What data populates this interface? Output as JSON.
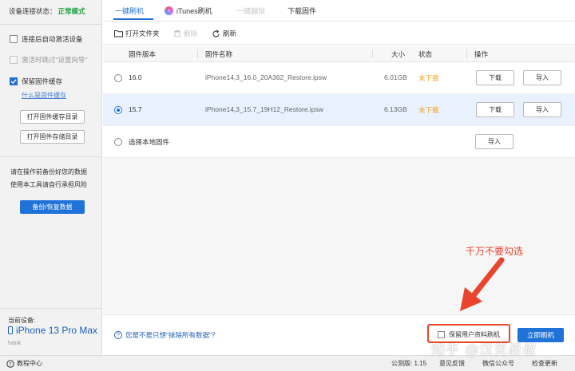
{
  "sidebar": {
    "status_label": "设备连接状态：",
    "status_value": "正常模式",
    "options": [
      {
        "label": "连接后自动激活设备",
        "checked": false,
        "disabled": false
      },
      {
        "label": "激活时跳过\"设置向导\"",
        "checked": false,
        "disabled": true
      },
      {
        "label": "保留固件缓存",
        "checked": true,
        "disabled": false
      }
    ],
    "cache_help_link": "什么是固件缓存",
    "open_cache_dir": "打开固件缓存目录",
    "open_store_dir": "打开固件存储目录",
    "warning_line1": "请在操作前备份好您的数据",
    "warning_line2": "使用本工具请自行承担风险",
    "backup_button": "备份/恢复数据",
    "current_device_label": "当前设备:",
    "device_name": "iPhone 13 Pro Max",
    "device_user": "hank"
  },
  "tabs": [
    {
      "label": "一键刷机",
      "active": true
    },
    {
      "label": "iTunes刷机",
      "active": false
    },
    {
      "label": "一键越狱",
      "disabled": true
    },
    {
      "label": "下载固件",
      "active": false
    }
  ],
  "toolbar": {
    "open_folder": "打开文件夹",
    "delete": "删除",
    "refresh": "刷新"
  },
  "table": {
    "headers": {
      "version": "固件版本",
      "name": "固件名称",
      "size": "大小",
      "status": "状态",
      "action": "操作"
    },
    "rows": [
      {
        "version": "16.0",
        "name": "iPhone14,3_16.0_20A362_Restore.ipsw",
        "size": "6.01GB",
        "status": "未下载",
        "download": "下载",
        "import": "导入",
        "selected": false
      },
      {
        "version": "15.7",
        "name": "iPhone14,3_15.7_19H12_Restore.ipsw",
        "size": "6.13GB",
        "status": "未下载",
        "download": "下载",
        "import": "导入",
        "selected": true
      }
    ],
    "local_row": {
      "label": "选择本地固件",
      "import": "导入"
    }
  },
  "annotation": {
    "text": "千万不要勾选",
    "color": "#e8452c"
  },
  "bottom": {
    "help_text": "您是不是只想\"抹除所有数据\"？",
    "keep_data_label": "保留用户资料刷机",
    "keep_data_checked": false,
    "flash_button": "立即刷机"
  },
  "statusbar": {
    "tutorial": "教程中心",
    "version": "公测版: 1.15",
    "feedback": "意见反馈",
    "wechat": "微信公众号",
    "update": "检查更新"
  },
  "watermark": "知乎 @汉克叔叔",
  "colors": {
    "accent": "#1f6fd6",
    "status_ok": "#1ea03c",
    "warning": "#f0a020",
    "annotation": "#e8452c"
  }
}
